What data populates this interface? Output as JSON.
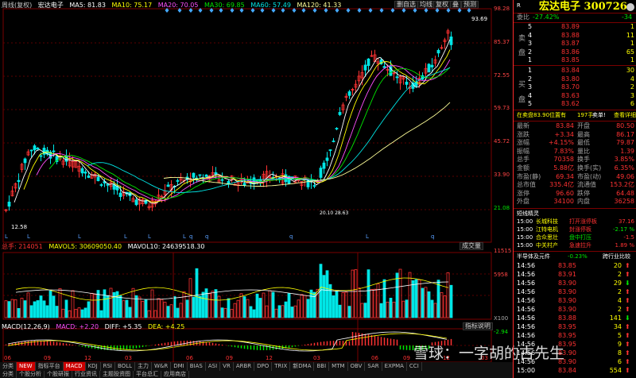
{
  "header": {
    "period": "周线(复权)",
    "name": "宏达电子",
    "ma": [
      {
        "label": "MA5: 81.83",
        "dir": "↑",
        "color": "#ffffff"
      },
      {
        "label": "MA10: 75.17",
        "dir": "↑",
        "color": "#ffff00"
      },
      {
        "label": "MA20: 70.05",
        "dir": "↑",
        "color": "#ff50ff"
      },
      {
        "label": "MA30: 69.85",
        "dir": "↑",
        "color": "#00e600"
      },
      {
        "label": "MA60: 57.49",
        "dir": "↑",
        "color": "#00e6e6"
      },
      {
        "label": "MA120: 41.33",
        "dir": "↑",
        "color": "#ffff99"
      }
    ],
    "buttons": [
      "删自选",
      "均线",
      "复权",
      "叠",
      "预测"
    ]
  },
  "price_axis": [
    "98.28",
    "85.37",
    "72.55",
    "59.73",
    "45.72",
    "33.90",
    "21.08"
  ],
  "annotations": {
    "high": "93.69",
    "low": "12.58",
    "mid": "20.10 28.63"
  },
  "volume": {
    "info": {
      "total": "总手: 214051",
      "mavol5": "MAVOL5: 30609050.40",
      "mavol10": "MAVOL10: 24639518.30"
    },
    "button": "成交量",
    "axis": [
      "11515",
      "5958",
      "X100"
    ]
  },
  "macd": {
    "info": {
      "title": "MACD(12,26,9)",
      "macd": "MACD: +2.20",
      "diff": "DIFF: +5.35",
      "dea": "DEA: +4.25"
    },
    "button": "指标说明",
    "axis": [
      "-2.94"
    ]
  },
  "time_axis": [
    "06",
    "09",
    "12",
    "03",
    "06",
    "09",
    "12",
    "03",
    "06",
    "09",
    "12",
    "03"
  ],
  "bottom_tabs": [
    "分类",
    "NEW",
    "指标平台",
    "MACD",
    "KDJ",
    "RSI",
    "BOLL",
    "主力",
    "W&R",
    "DMI",
    "BIAS",
    "ASI",
    "VR",
    "ARBR",
    "DPO",
    "TRIX",
    "新DMA",
    "BBI",
    "MTM",
    "OBV",
    "SAR",
    "EXPMA",
    "CCI"
  ],
  "bottom_tabs2": [
    "分类",
    "个股分析",
    "个股研报",
    "行业资讯",
    "主题投资图",
    "平台总汇",
    "应用商店"
  ],
  "watermark": "雪球：一字胡的古先生",
  "side": {
    "title_r": "R",
    "stock": "宏达电子 300726",
    "weibi": {
      "label": "委比",
      "value": "-27.42%",
      "diff": "-34"
    },
    "sell": [
      {
        "n": "5",
        "p": "83.89",
        "v": "1"
      },
      {
        "n": "4",
        "p": "83.88",
        "v": "11"
      },
      {
        "n": "3",
        "p": "83.87",
        "v": "1"
      },
      {
        "n": "2",
        "p": "83.86",
        "v": "65"
      },
      {
        "n": "1",
        "p": "83.85",
        "v": "1"
      }
    ],
    "buy": [
      {
        "n": "1",
        "p": "83.84",
        "v": "30"
      },
      {
        "n": "2",
        "p": "83.80",
        "v": "4"
      },
      {
        "n": "3",
        "p": "83.70",
        "v": "2"
      },
      {
        "n": "4",
        "p": "83.63",
        "v": "3"
      },
      {
        "n": "5",
        "p": "83.62",
        "v": "6"
      }
    ],
    "sell_label": [
      "卖",
      "盘"
    ],
    "buy_label": [
      "买",
      "盘"
    ],
    "order_line": {
      "text": "在卖盘83.90位置有",
      "qty": "197手",
      "act": "卖单!",
      "link": "查看详细"
    },
    "quote": [
      {
        "l": "最新",
        "lv": "83.84",
        "r": "开盘",
        "rv": "80.50"
      },
      {
        "l": "涨跌",
        "lv": "+3.34",
        "r": "最高",
        "rv": "86.17"
      },
      {
        "l": "涨幅",
        "lv": "+4.15%",
        "r": "最低",
        "rv": "79.87"
      },
      {
        "l": "振幅",
        "lv": "7.83%",
        "r": "量比",
        "rv": "1.39"
      },
      {
        "l": "总手",
        "lv": "70358",
        "r": "换手",
        "rv": "3.85%"
      },
      {
        "l": "金额",
        "lv": "5.88亿",
        "r": "换手(实)",
        "rv": "6.35%"
      },
      {
        "l": "市盈(静)",
        "lv": "69.34",
        "r": "市盈(动)",
        "rv": "49.06"
      },
      {
        "l": "总市值",
        "lv": "335.4亿",
        "r": "流通值",
        "rv": "153.2亿"
      },
      {
        "l": "涨停",
        "lv": "96.60",
        "r": "跌停",
        "rv": "64.48"
      },
      {
        "l": "外盘",
        "lv": "34100",
        "r": "内盘",
        "rv": "36258"
      }
    ],
    "news_title": "短线精灵",
    "news": [
      {
        "t": "15:00",
        "n": "长城科技",
        "e": "打开涨停板",
        "v": "37.16"
      },
      {
        "t": "15:00",
        "n": "江特电机",
        "e": "封涨停板",
        "v": "-2.17 %"
      },
      {
        "t": "15:00",
        "n": "合众思壮",
        "e": "盘中打压",
        "v": "-1.5"
      },
      {
        "t": "15:00",
        "n": "中关村产",
        "e": "急速拉升",
        "v": "1.89 %"
      }
    ],
    "tick_header": {
      "a": "半导体及元件",
      "b": "-0.23%",
      "c": "跨行业比较"
    },
    "ticks": [
      {
        "t": "14:56",
        "p": "83.85",
        "v": "20"
      },
      {
        "t": "14:56",
        "p": "83.91",
        "v": "2"
      },
      {
        "t": "14:56",
        "p": "83.90",
        "v": "29"
      },
      {
        "t": "14:56",
        "p": "83.90",
        "v": "2"
      },
      {
        "t": "14:56",
        "p": "83.90",
        "v": "4"
      },
      {
        "t": "14:56",
        "p": "83.90",
        "v": "2"
      },
      {
        "t": "14:56",
        "p": "83.88",
        "v": "141"
      },
      {
        "t": "14:56",
        "p": "83.95",
        "v": "34"
      },
      {
        "t": "14:56",
        "p": "83.95",
        "v": "5"
      },
      {
        "t": "14:56",
        "p": "83.95",
        "v": "9"
      },
      {
        "t": "14:56",
        "p": "83.90",
        "v": "8"
      },
      {
        "t": "14:56",
        "p": "83.90",
        "v": "6"
      },
      {
        "t": "15:00",
        "p": "83.84",
        "v": "554"
      }
    ]
  },
  "colors": {
    "up": "#ff3232",
    "down": "#00e6e6",
    "border": "#ff2a2a"
  }
}
